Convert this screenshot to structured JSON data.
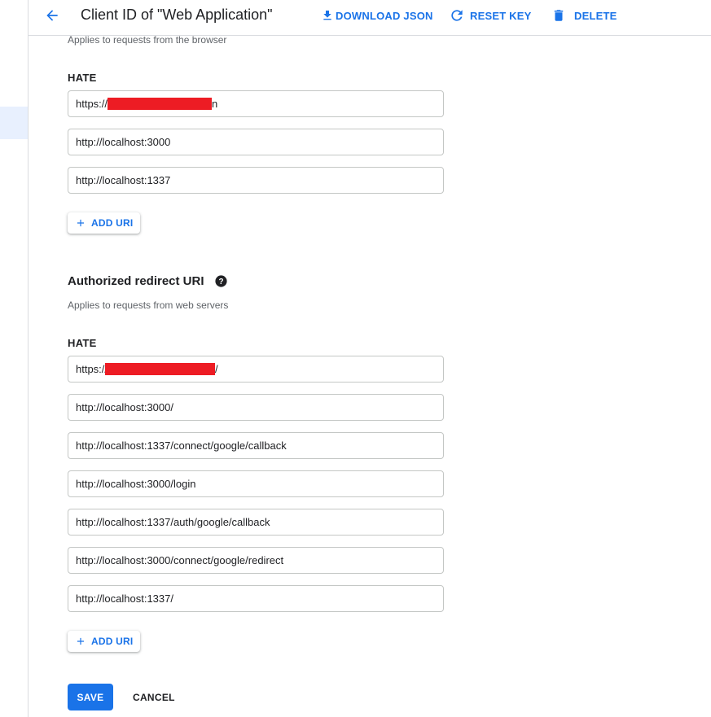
{
  "header": {
    "title": "Client ID of \"Web Application\"",
    "download_label": "DOWNLOAD JSON",
    "reset_label": "RESET KEY",
    "delete_label": "DELETE",
    "accent": "#1a73e8"
  },
  "origins": {
    "hint": "Applies to requests from the browser",
    "label": "HATE",
    "uris": [
      {
        "prefix": "https://",
        "suffix": "n"
      },
      {
        "value": "http://localhost:3000"
      },
      {
        "value": "http://localhost:1337"
      }
    ],
    "add_label": "ADD URI"
  },
  "redirects": {
    "title": "Authorized redirect URI",
    "hint": "Applies to requests from web servers",
    "label": "HATE",
    "uris": [
      {
        "prefix": "https://",
        "suffix": "/"
      },
      {
        "value": "http://localhost:3000/"
      },
      {
        "value": "http://localhost:1337/connect/google/callback"
      },
      {
        "value": "http://localhost:3000/login"
      },
      {
        "value": "http://localhost:1337/auth/google/callback"
      },
      {
        "value": "http://localhost:3000/connect/google/redirect"
      },
      {
        "value": "http://localhost:1337/"
      }
    ],
    "add_label": "ADD URI"
  },
  "footer": {
    "save_label": "SAVE",
    "cancel_label": "CANCEL"
  },
  "icons": {
    "back": "arrow-back-icon",
    "download": "download-icon",
    "reset": "refresh-icon",
    "delete": "trash-icon",
    "help": "help-circle-icon",
    "add": "plus-icon"
  },
  "colors": {
    "redaction": "#ed1c24"
  }
}
